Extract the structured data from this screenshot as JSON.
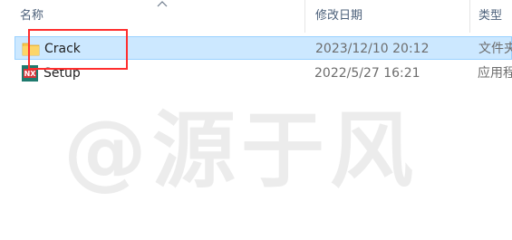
{
  "columns": {
    "name": "名称",
    "date": "修改日期",
    "type": "类型"
  },
  "files": [
    {
      "name": "Crack",
      "date": "2023/12/10 20:12",
      "type": "文件夹",
      "icon": "folder-icon",
      "selected": true
    },
    {
      "name": "Setup",
      "date": "2022/5/27 16:21",
      "type": "应用程",
      "icon": "nx-app-icon",
      "selected": false
    }
  ],
  "watermark": "@源于风",
  "colors": {
    "selection_bg": "#cce8ff",
    "selection_border": "#99d1ff",
    "highlight_box": "#ff2e2e",
    "folder": "#f8c64a"
  }
}
